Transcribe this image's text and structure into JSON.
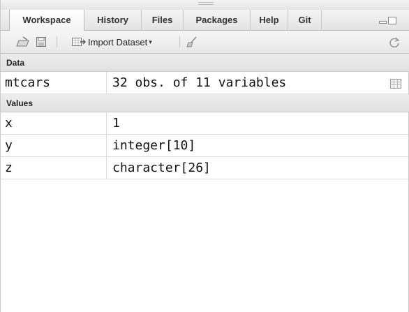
{
  "tabs": [
    {
      "label": "Workspace",
      "active": true
    },
    {
      "label": "History"
    },
    {
      "label": "Files"
    },
    {
      "label": "Packages"
    },
    {
      "label": "Help"
    },
    {
      "label": "Git"
    }
  ],
  "toolbar": {
    "import_label": "Import Dataset",
    "icons": [
      "load-workspace-icon",
      "save-workspace-icon",
      "import-dataset-icon",
      "clear-broom-icon",
      "refresh-icon"
    ]
  },
  "sections": {
    "data": "Data",
    "values": "Values"
  },
  "data_rows": [
    {
      "name": "mtcars",
      "value": "32 obs. of 11 variables"
    }
  ],
  "value_rows": [
    {
      "name": "x",
      "value": "1"
    },
    {
      "name": "y",
      "value": "integer[10]"
    },
    {
      "name": "z",
      "value": "character[26]"
    }
  ],
  "colors": {
    "accent_green": "#3a9d3a",
    "header_bg": "#e6e6e6"
  }
}
